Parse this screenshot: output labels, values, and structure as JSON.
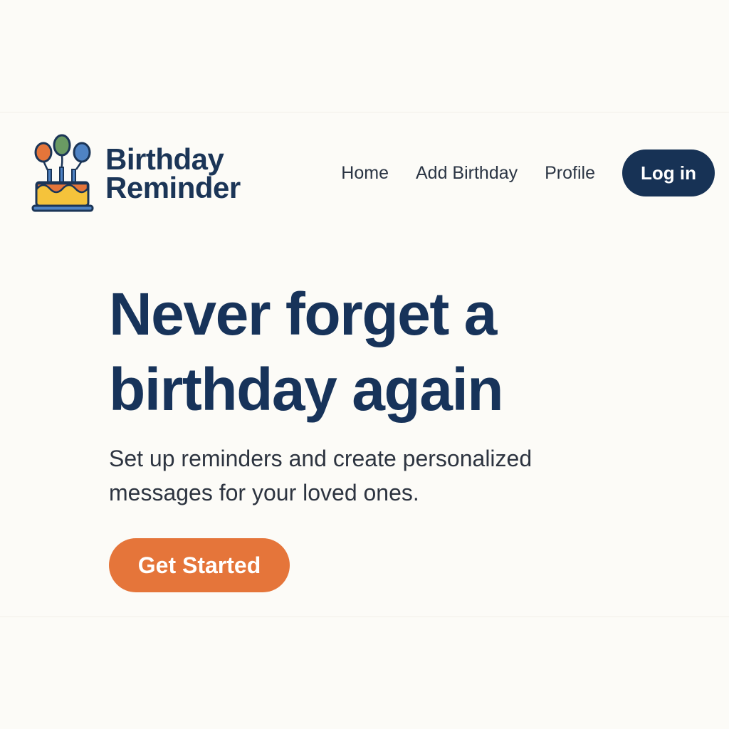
{
  "logo": {
    "line1": "Birthday",
    "line2": "Reminder",
    "icon": "birthday-cake-balloons-icon"
  },
  "nav": {
    "items": [
      {
        "label": "Home"
      },
      {
        "label": "Add Birthday"
      },
      {
        "label": "Profile"
      }
    ],
    "login_label": "Log in"
  },
  "hero": {
    "title_line1": "Never forget a",
    "title_line2": "birthday again",
    "subtitle": "Set up reminders and create personalized messages for your loved ones.",
    "cta_label": "Get Started"
  },
  "colors": {
    "background": "#fcfbf7",
    "primary_navy": "#173255",
    "accent_orange": "#e5753a",
    "balloon_green": "#6a9a63",
    "balloon_blue": "#4f83c4",
    "cake_yellow": "#f5c33b"
  }
}
